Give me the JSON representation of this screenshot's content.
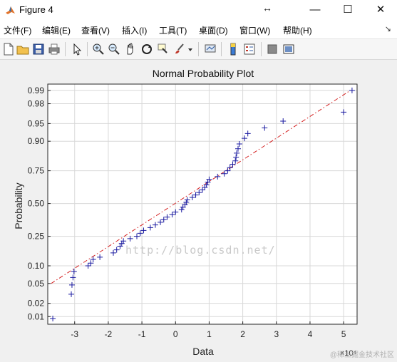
{
  "window": {
    "title": "Figure 4",
    "buttons": [
      "—",
      "☐",
      "✕"
    ]
  },
  "menubar": {
    "items": [
      "文件(F)",
      "编辑(E)",
      "查看(V)",
      "插入(I)",
      "工具(T)",
      "桌面(D)",
      "窗口(W)",
      "帮助(H)"
    ],
    "end_glyph": "↘"
  },
  "toolbar": {
    "icons": [
      "new-figure-icon",
      "open-file-icon",
      "save-icon",
      "print-icon",
      "pointer-icon",
      "zoom-in-icon",
      "zoom-out-icon",
      "pan-hand-icon",
      "rotate-3d-icon",
      "data-cursor-icon",
      "brush-icon",
      "link-plot-icon",
      "colorbar-icon",
      "legend-icon",
      "hide-plot-tools-icon",
      "show-plot-tools-icon"
    ]
  },
  "chart_data": {
    "type": "scatter",
    "title": "Normal Probability Plot",
    "xlabel": "Data",
    "ylabel": "Probability",
    "x_exponent_label": "×10⁴",
    "xlim": [
      -3.8,
      5.4
    ],
    "x_ticks": [
      -3,
      -2,
      -1,
      0,
      1,
      2,
      3,
      4,
      5
    ],
    "y_ticks": [
      0.01,
      0.02,
      0.05,
      0.1,
      0.25,
      0.5,
      0.75,
      0.9,
      0.95,
      0.98,
      0.99
    ],
    "y_tick_labels": [
      "0.01",
      "0.02",
      "0.05",
      "0.10",
      "0.25",
      "0.50",
      "0.75",
      "0.90",
      "0.95",
      "0.98",
      "0.99"
    ],
    "grid": true,
    "marker": "+",
    "colors": {
      "points": "#1a1aa0",
      "reference_line": "#d42020",
      "grid": "#d8d8d8"
    },
    "reference_line": {
      "x": [
        -3.7,
        5.2
      ],
      "p": [
        0.05,
        0.99
      ],
      "style": "dash-dot"
    },
    "points": [
      {
        "x": -3.65,
        "p": 0.009
      },
      {
        "x": -3.1,
        "p": 0.031
      },
      {
        "x": -3.08,
        "p": 0.047
      },
      {
        "x": -3.05,
        "p": 0.064
      },
      {
        "x": -3.02,
        "p": 0.081
      },
      {
        "x": -2.6,
        "p": 0.1
      },
      {
        "x": -2.52,
        "p": 0.11
      },
      {
        "x": -2.45,
        "p": 0.125
      },
      {
        "x": -2.25,
        "p": 0.135
      },
      {
        "x": -1.85,
        "p": 0.155
      },
      {
        "x": -1.75,
        "p": 0.17
      },
      {
        "x": -1.65,
        "p": 0.19
      },
      {
        "x": -1.6,
        "p": 0.205
      },
      {
        "x": -1.55,
        "p": 0.22
      },
      {
        "x": -1.35,
        "p": 0.235
      },
      {
        "x": -1.15,
        "p": 0.25
      },
      {
        "x": -1.05,
        "p": 0.27
      },
      {
        "x": -0.95,
        "p": 0.29
      },
      {
        "x": -0.75,
        "p": 0.31
      },
      {
        "x": -0.6,
        "p": 0.33
      },
      {
        "x": -0.45,
        "p": 0.35
      },
      {
        "x": -0.35,
        "p": 0.37
      },
      {
        "x": -0.25,
        "p": 0.39
      },
      {
        "x": -0.1,
        "p": 0.41
      },
      {
        "x": 0.0,
        "p": 0.43
      },
      {
        "x": 0.18,
        "p": 0.45
      },
      {
        "x": 0.22,
        "p": 0.47
      },
      {
        "x": 0.28,
        "p": 0.49
      },
      {
        "x": 0.32,
        "p": 0.51
      },
      {
        "x": 0.35,
        "p": 0.53
      },
      {
        "x": 0.5,
        "p": 0.55
      },
      {
        "x": 0.6,
        "p": 0.57
      },
      {
        "x": 0.7,
        "p": 0.59
      },
      {
        "x": 0.8,
        "p": 0.61
      },
      {
        "x": 0.87,
        "p": 0.63
      },
      {
        "x": 0.92,
        "p": 0.65
      },
      {
        "x": 0.96,
        "p": 0.67
      },
      {
        "x": 1.0,
        "p": 0.69
      },
      {
        "x": 1.25,
        "p": 0.71
      },
      {
        "x": 1.45,
        "p": 0.73
      },
      {
        "x": 1.55,
        "p": 0.75
      },
      {
        "x": 1.62,
        "p": 0.77
      },
      {
        "x": 1.7,
        "p": 0.79
      },
      {
        "x": 1.78,
        "p": 0.81
      },
      {
        "x": 1.8,
        "p": 0.83
      },
      {
        "x": 1.82,
        "p": 0.85
      },
      {
        "x": 1.86,
        "p": 0.87
      },
      {
        "x": 1.9,
        "p": 0.89
      },
      {
        "x": 2.05,
        "p": 0.91
      },
      {
        "x": 2.15,
        "p": 0.925
      },
      {
        "x": 2.65,
        "p": 0.94
      },
      {
        "x": 3.2,
        "p": 0.955
      },
      {
        "x": 5.0,
        "p": 0.97
      },
      {
        "x": 5.25,
        "p": 0.99
      }
    ]
  },
  "watermark": "http://blog.csdn.net/",
  "credit": "@稀土掘金技术社区"
}
